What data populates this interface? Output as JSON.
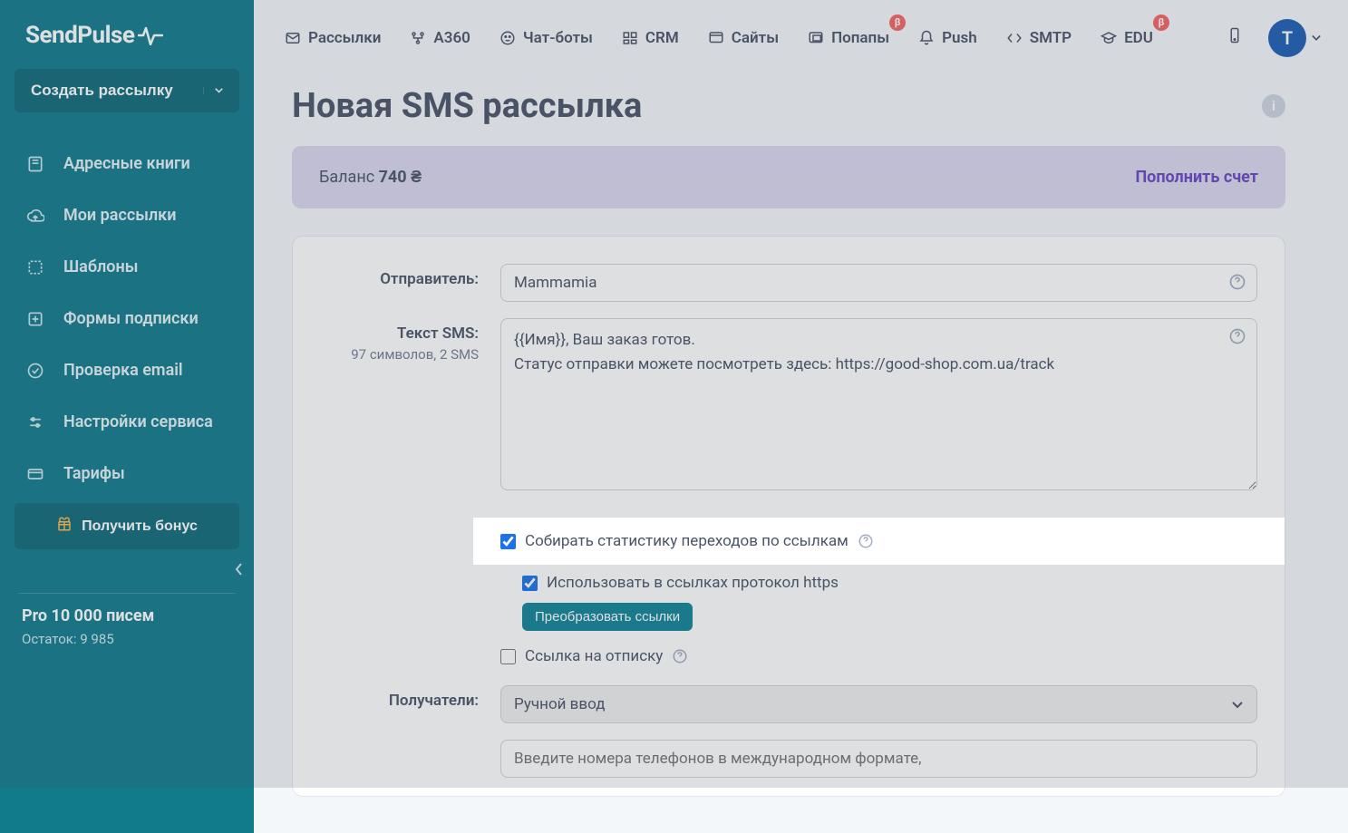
{
  "brand": "SendPulse",
  "sidebar": {
    "create_label": "Создать рассылку",
    "items": [
      {
        "label": "Адресные книги",
        "icon": "book"
      },
      {
        "label": "Мои рассылки",
        "icon": "cloud-upload"
      },
      {
        "label": "Шаблоны",
        "icon": "template"
      },
      {
        "label": "Формы подписки",
        "icon": "form"
      },
      {
        "label": "Проверка email",
        "icon": "check-circle"
      },
      {
        "label": "Настройки сервиса",
        "icon": "sliders"
      },
      {
        "label": "Тарифы",
        "icon": "credit-card"
      }
    ],
    "bonus_label": "Получить бонус",
    "plan_title": "Pro 10 000 писем",
    "plan_remain": "Остаток: 9 985"
  },
  "topnav": {
    "items": [
      {
        "label": "Рассылки",
        "icon": "mail",
        "beta": false
      },
      {
        "label": "A360",
        "icon": "automation",
        "beta": false
      },
      {
        "label": "Чат-боты",
        "icon": "chat",
        "beta": false
      },
      {
        "label": "CRM",
        "icon": "crm",
        "beta": false
      },
      {
        "label": "Сайты",
        "icon": "site",
        "beta": false
      },
      {
        "label": "Попапы",
        "icon": "popup",
        "beta": true
      },
      {
        "label": "Push",
        "icon": "bell",
        "beta": false
      },
      {
        "label": "SMTP",
        "icon": "code",
        "beta": false
      },
      {
        "label": "EDU",
        "icon": "edu",
        "beta": true
      }
    ],
    "avatar_initial": "T",
    "beta_char": "β"
  },
  "page_title": "Новая SMS рассылка",
  "balance": {
    "label": "Баланс",
    "amount": "740 ₴",
    "topup": "Пополнить счет"
  },
  "form": {
    "sender_label": "Отправитель:",
    "sender_value": "Mammamia",
    "text_label": "Текст SMS:",
    "text_counter": "97 символов, 2 SMS",
    "text_value": "{{Имя}}, Ваш заказ готов.\nСтатус отправки можете посмотреть здесь: https://good-shop.com.ua/track",
    "stats_checkbox": "Собирать статистику переходов по ссылкам",
    "https_checkbox": "Использовать в ссылках протокол https",
    "convert_button": "Преобразовать ссылки",
    "unsubscribe_checkbox": "Ссылка на отписку",
    "recipients_label": "Получатели:",
    "recipients_value": "Ручной ввод",
    "phones_placeholder": "Введите номера телефонов в международном формате,"
  }
}
